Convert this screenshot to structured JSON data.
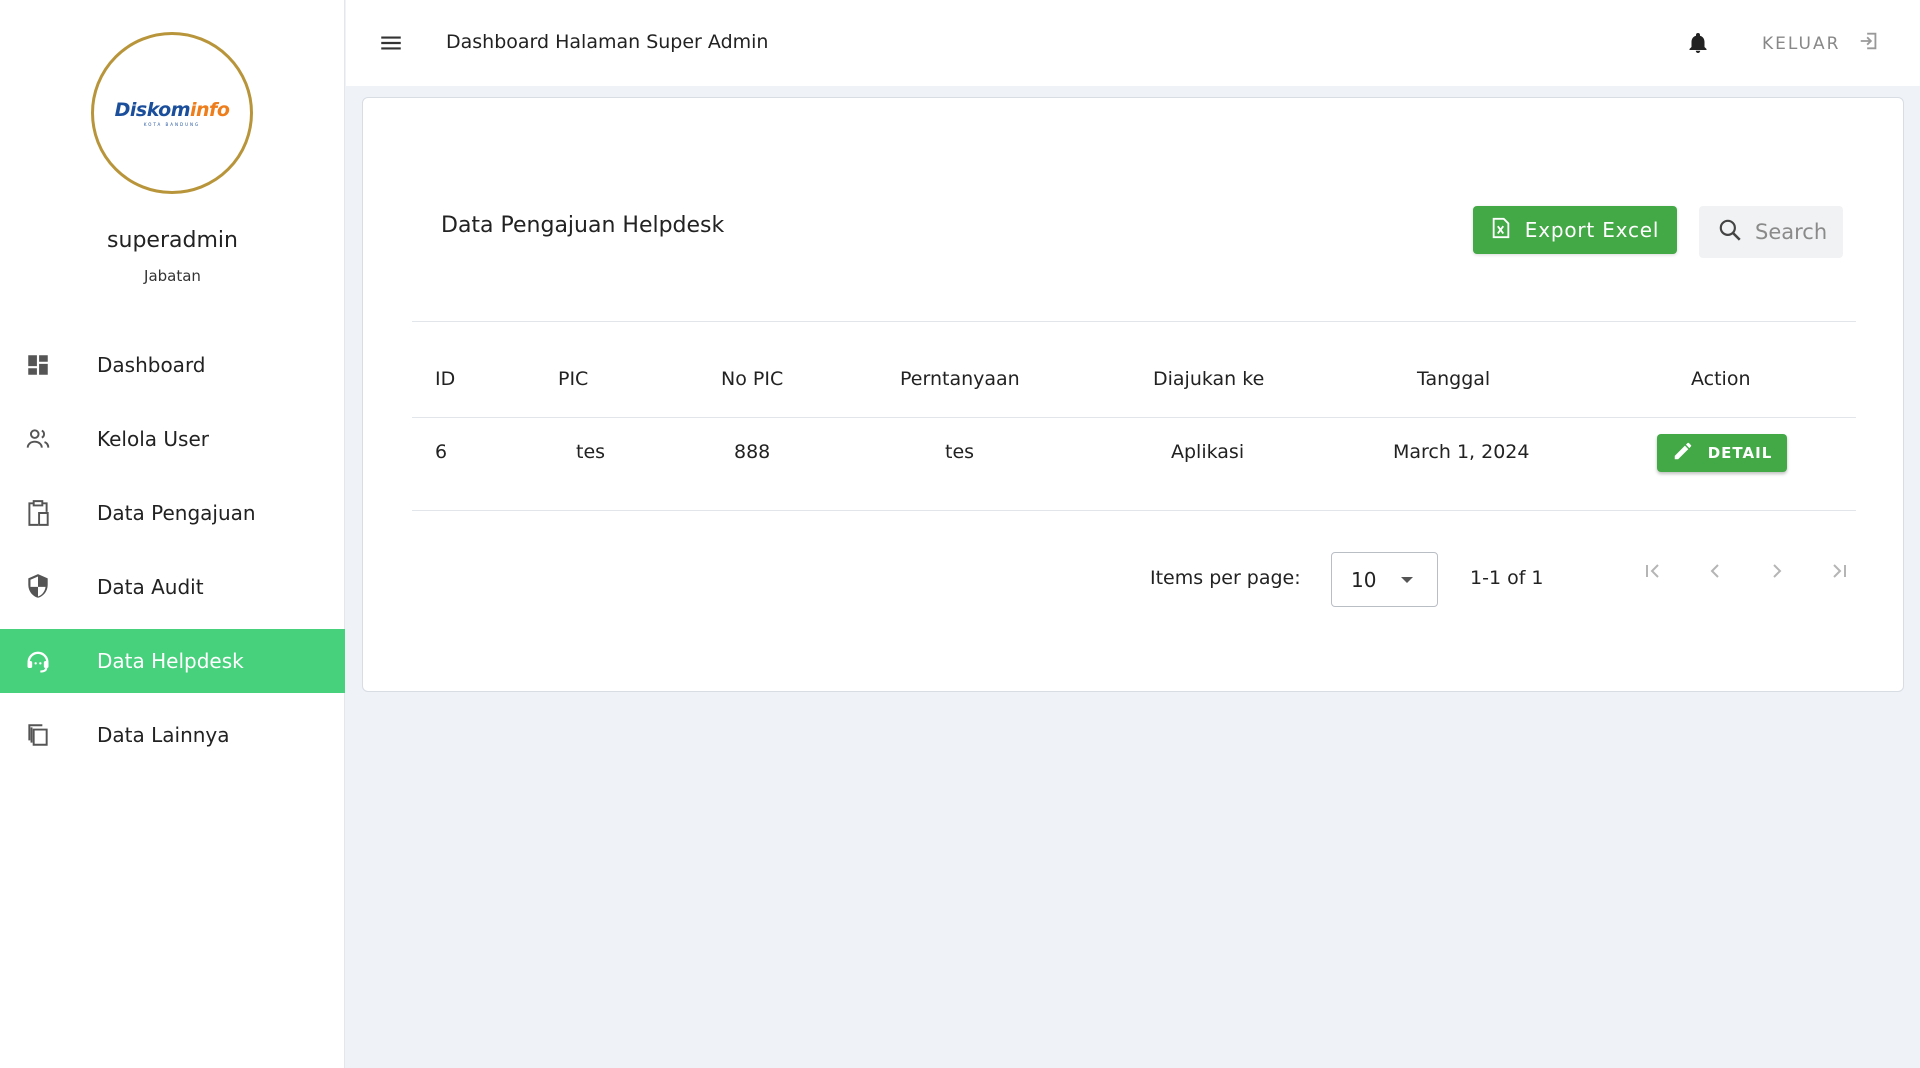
{
  "brand": {
    "logo_part1": "Diskom",
    "logo_part2": "info",
    "logo_sub": "KOTA BANDUNG"
  },
  "user": {
    "name": "superadmin",
    "role": "Jabatan"
  },
  "sidebar": {
    "items": [
      {
        "label": "Dashboard",
        "icon": "dashboard-icon",
        "active": false
      },
      {
        "label": "Kelola User",
        "icon": "users-icon",
        "active": false
      },
      {
        "label": "Data Pengajuan",
        "icon": "clipboard-icon",
        "active": false
      },
      {
        "label": "Data Audit",
        "icon": "shield-icon",
        "active": false
      },
      {
        "label": "Data Helpdesk",
        "icon": "support-agent-icon",
        "active": true
      },
      {
        "label": "Data Lainnya",
        "icon": "copy-icon",
        "active": false
      }
    ]
  },
  "topbar": {
    "title": "Dashboard Halaman Super Admin",
    "logout_label": "KELUAR"
  },
  "card": {
    "title": "Data Pengajuan Helpdesk",
    "export_label": "Export Excel",
    "search_placeholder": "Search"
  },
  "table": {
    "headers": [
      "ID",
      "PIC",
      "No PIC",
      "Perntanyaan",
      "Diajukan ke",
      "Tanggal",
      "Action"
    ],
    "rows": [
      {
        "id": "6",
        "pic": "tes",
        "no_pic": "888",
        "pertanyaan": "tes",
        "diajukan_ke": "Aplikasi",
        "tanggal": "March 1, 2024",
        "action": "DETAIL"
      }
    ]
  },
  "pagination": {
    "items_per_page_label": "Items per page:",
    "items_per_page": "10",
    "range": "1-1 of 1"
  },
  "colors": {
    "accent_green": "#47d17d",
    "button_green": "#43a846",
    "logo_ring": "#b8953a",
    "background": "#eff3f8"
  }
}
